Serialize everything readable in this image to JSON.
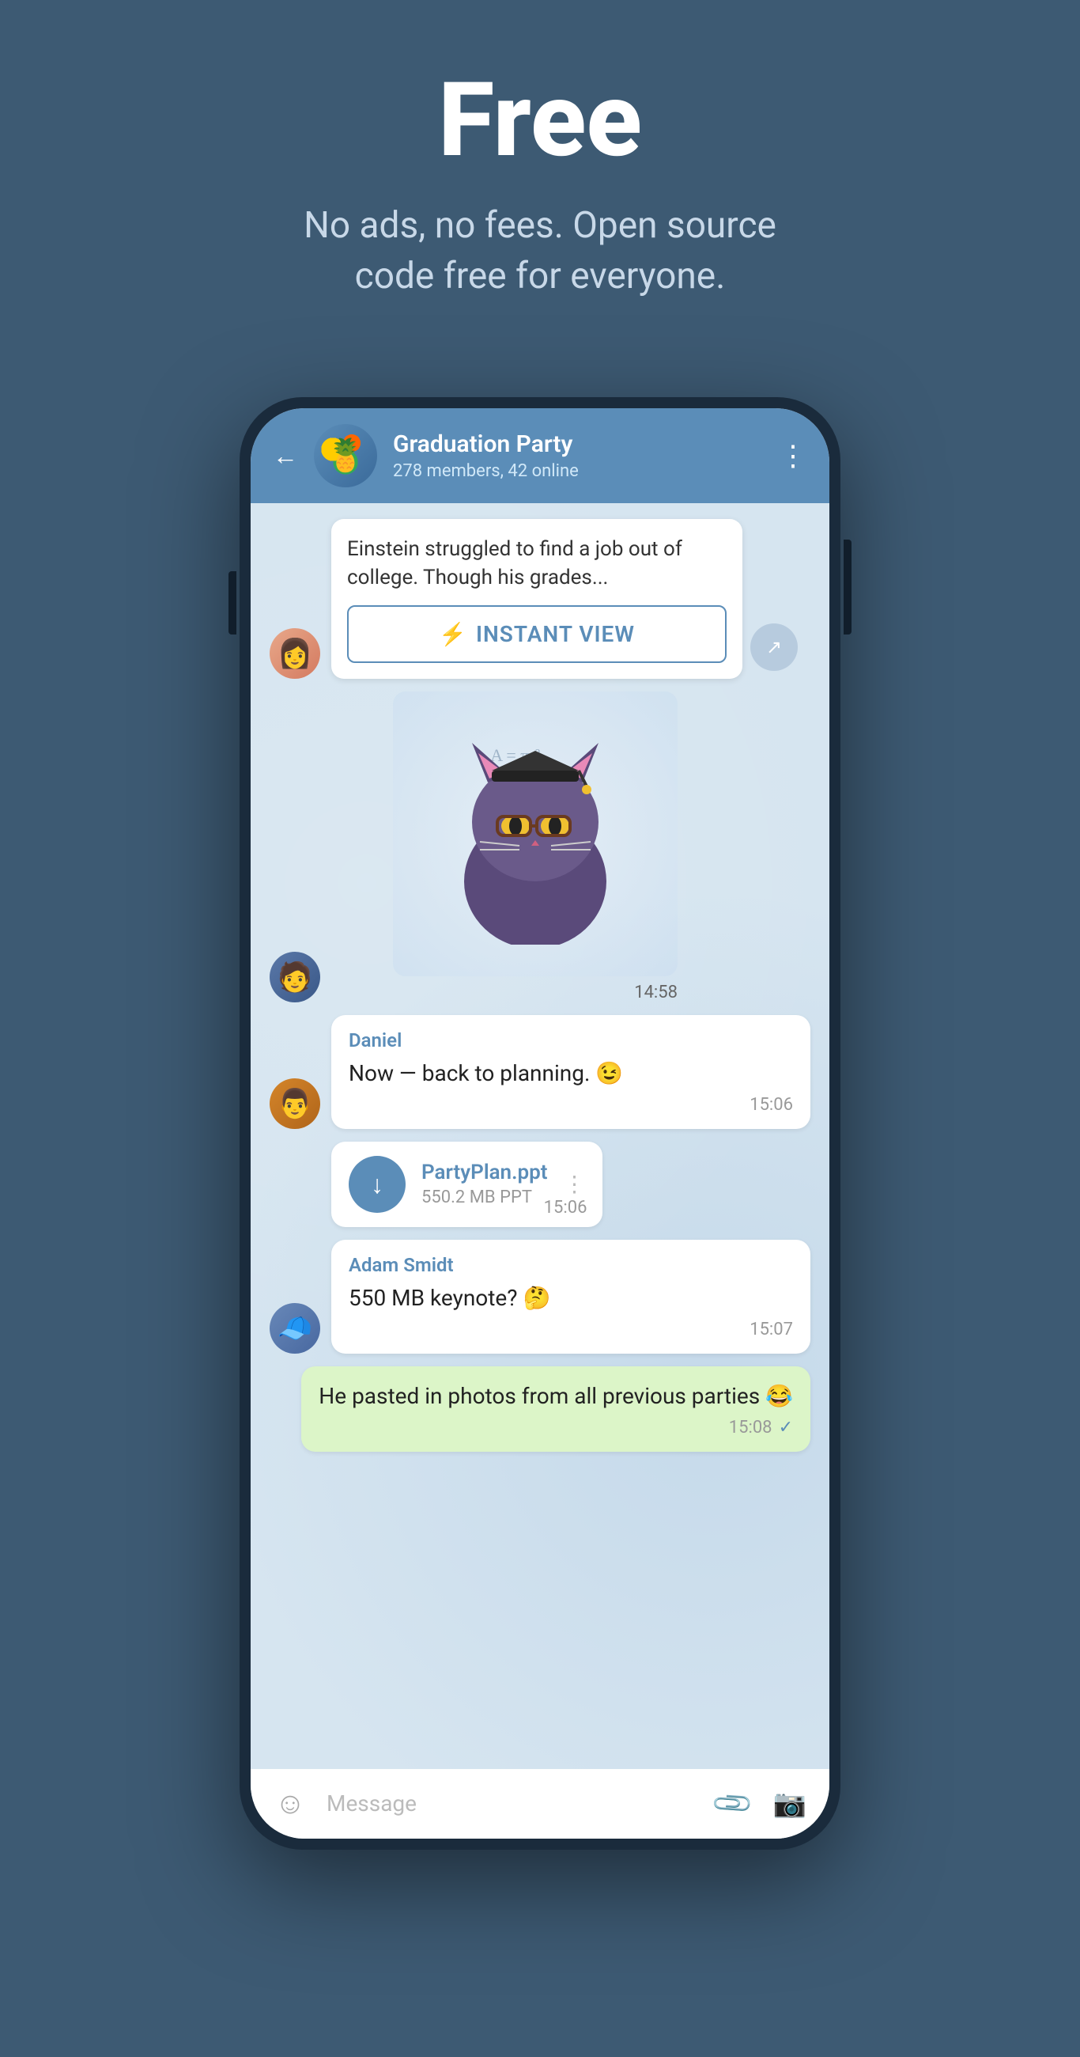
{
  "hero": {
    "title": "Free",
    "subtitle": "No ads, no fees. Open source code free for everyone."
  },
  "phone": {
    "header": {
      "group_name": "Graduation Party",
      "group_members": "278 members, 42 online",
      "back_label": "←",
      "more_label": "⋮"
    },
    "chat": {
      "article": {
        "text": "Einstein struggled to find a job out of college. Though his grades...",
        "instant_view_label": "INSTANT VIEW"
      },
      "sticker_time": "14:58",
      "messages": [
        {
          "id": "daniel-msg",
          "sender": "Daniel",
          "text": "Now — back to planning. 😉",
          "time": "15:06",
          "type": "text"
        },
        {
          "id": "file-msg",
          "file_name": "PartyPlan.ppt",
          "file_size": "550.2 MB PPT",
          "time": "15:06",
          "type": "file"
        },
        {
          "id": "adam-msg",
          "sender": "Adam Smidt",
          "text": "550 MB keynote? 🤔",
          "time": "15:07",
          "type": "text"
        },
        {
          "id": "self-msg",
          "text": "He pasted in photos from all previous parties 😂",
          "time": "15:08",
          "type": "self",
          "check": "✓"
        }
      ]
    },
    "input_bar": {
      "placeholder": "Message"
    }
  }
}
